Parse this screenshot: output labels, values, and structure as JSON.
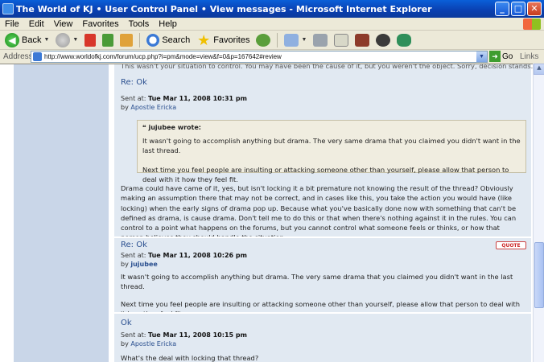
{
  "window": {
    "title": "The World of KJ • User Control Panel • View messages - Microsoft Internet Explorer",
    "minimize": "_",
    "maximize": "□",
    "close": "✕"
  },
  "menu": [
    "File",
    "Edit",
    "View",
    "Favorites",
    "Tools",
    "Help"
  ],
  "toolbar": {
    "back_label": "Back",
    "search_label": "Search",
    "favorites_label": "Favorites"
  },
  "address": {
    "label": "Address",
    "url": "http://www.worldofkj.com/forum/ucp.php?i=pm&mode=view&f=0&p=167642#review",
    "go_label": "Go",
    "links_label": "Links"
  },
  "page": {
    "top_fragment": "This wasn't your situation to control. You may have been the cause of it, but you weren't the object. Sorry, decision stands.",
    "posts": [
      {
        "title": "Re: Ok",
        "sent_label": "Sent at:",
        "sent_date": "Tue Mar 11, 2008 10:31 pm",
        "by_label": "by",
        "author": "Apostle Ericka",
        "quote": {
          "author_line": "jujubee wrote:",
          "lines": [
            "It wasn't going to accomplish anything but drama. The very same drama that you claimed you didn't want in the last thread.",
            "Next time you feel people are insulting or attacking someone other than yourself, please allow that person to deal with it how they feel fit."
          ]
        },
        "body": "Drama could have came of it, yes, but isn't locking it a bit premature not knowing the result of the thread? Obviously making an assumption there that may not be correct, and in cases like this, you take the action you would have (like locking) when the early signs of drama pop up. Because what you've basically done now with something that can't be defined as drama, is cause drama. Don't tell me to do this or that when there's nothing against it in the rules. You can control to a point what happens on the forums, but you cannot control what someone feels or thinks, or how that person believes they should handle the situation."
      },
      {
        "title": "Re: Ok",
        "sent_label": "Sent at:",
        "sent_date": "Tue Mar 11, 2008 10:26 pm",
        "by_label": "by",
        "author": "jujubee",
        "quote_button": "QUOTE",
        "body_lines": [
          "It wasn't going to accomplish anything but drama. The very same drama that you claimed you didn't want in the last thread.",
          "Next time you feel people are insulting or attacking someone other than yourself, please allow that person to deal with it how they feel fit."
        ]
      },
      {
        "title": "Ok",
        "sent_label": "Sent at:",
        "sent_date": "Tue Mar 11, 2008 10:15 pm",
        "by_label": "by",
        "author": "Apostle Ericka",
        "body": "What's the deal with locking that thread?"
      }
    ]
  },
  "colors": {
    "post_bg": "#e1e9f2",
    "sidebar_bg": "#c9d6e8",
    "link": "#2a4f8f",
    "quote_bg": "#f0ede0"
  }
}
